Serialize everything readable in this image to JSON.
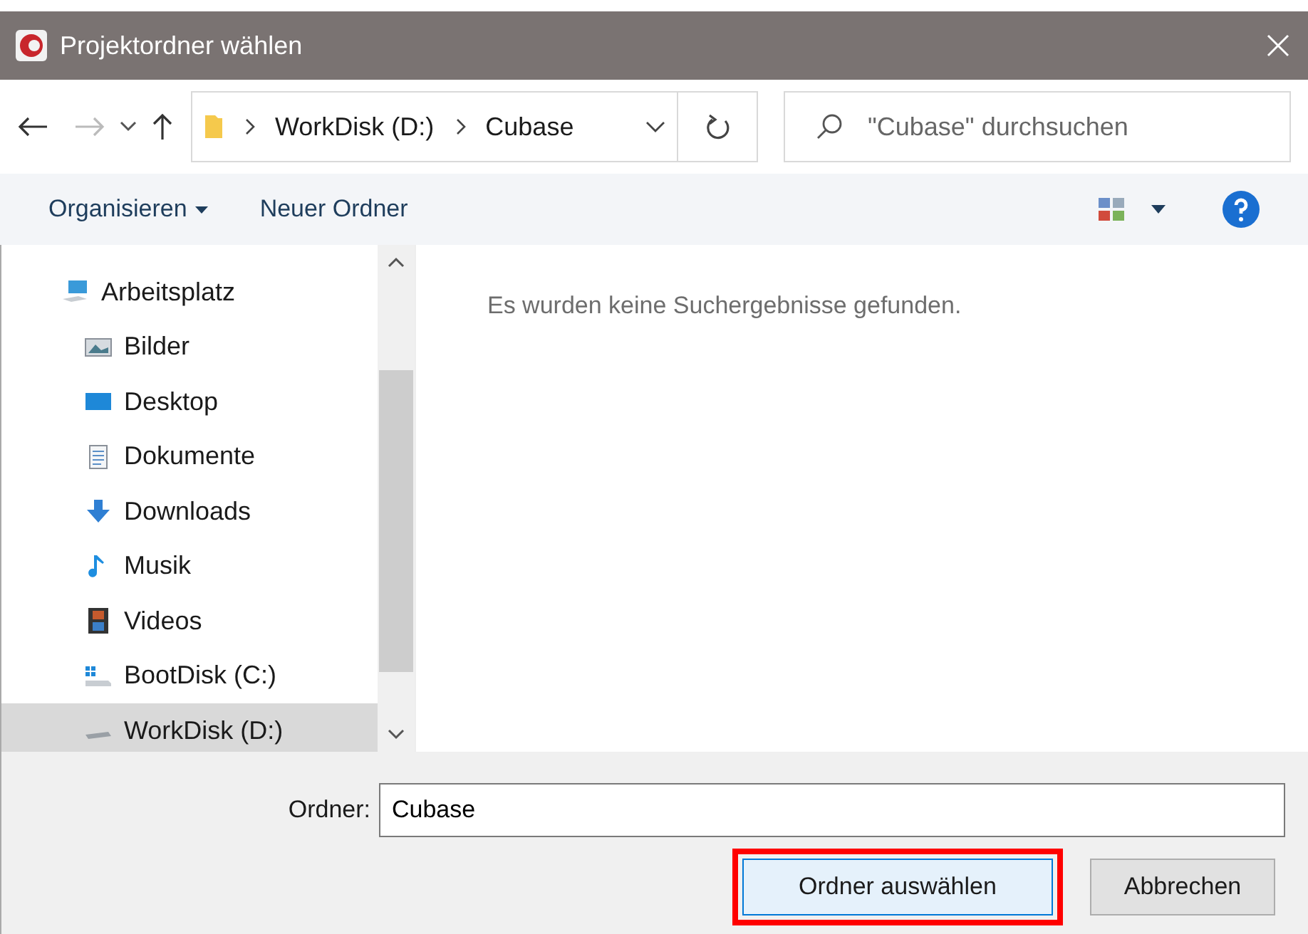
{
  "window": {
    "title": "Projektordner wählen"
  },
  "address_bar": {
    "path": [
      {
        "label": "WorkDisk (D:)"
      },
      {
        "label": "Cubase"
      }
    ]
  },
  "search": {
    "placeholder": "\"Cubase\" durchsuchen"
  },
  "toolbar": {
    "organize": "Organisieren",
    "new_folder": "Neuer Ordner"
  },
  "sidebar": {
    "items": [
      {
        "label": "Arbeitsplatz",
        "kind": "computer",
        "selected": false,
        "children": [
          {
            "label": "Bilder",
            "kind": "pictures",
            "selected": false
          },
          {
            "label": "Desktop",
            "kind": "desktop",
            "selected": false
          },
          {
            "label": "Dokumente",
            "kind": "documents",
            "selected": false
          },
          {
            "label": "Downloads",
            "kind": "downloads",
            "selected": false
          },
          {
            "label": "Musik",
            "kind": "music",
            "selected": false
          },
          {
            "label": "Videos",
            "kind": "videos",
            "selected": false
          },
          {
            "label": "BootDisk (C:)",
            "kind": "systemdrive",
            "selected": false
          },
          {
            "label": "WorkDisk (D:)",
            "kind": "drive",
            "selected": true
          }
        ]
      }
    ]
  },
  "content": {
    "message": "Es wurden keine Suchergebnisse gefunden."
  },
  "folder_field": {
    "label": "Ordner:",
    "value": "Cubase"
  },
  "buttons": [
    {
      "label": "Ordner auswählen",
      "kind": "primary",
      "highlighted": true
    },
    {
      "label": "Abbrechen",
      "kind": "secondary",
      "highlighted": false
    }
  ]
}
